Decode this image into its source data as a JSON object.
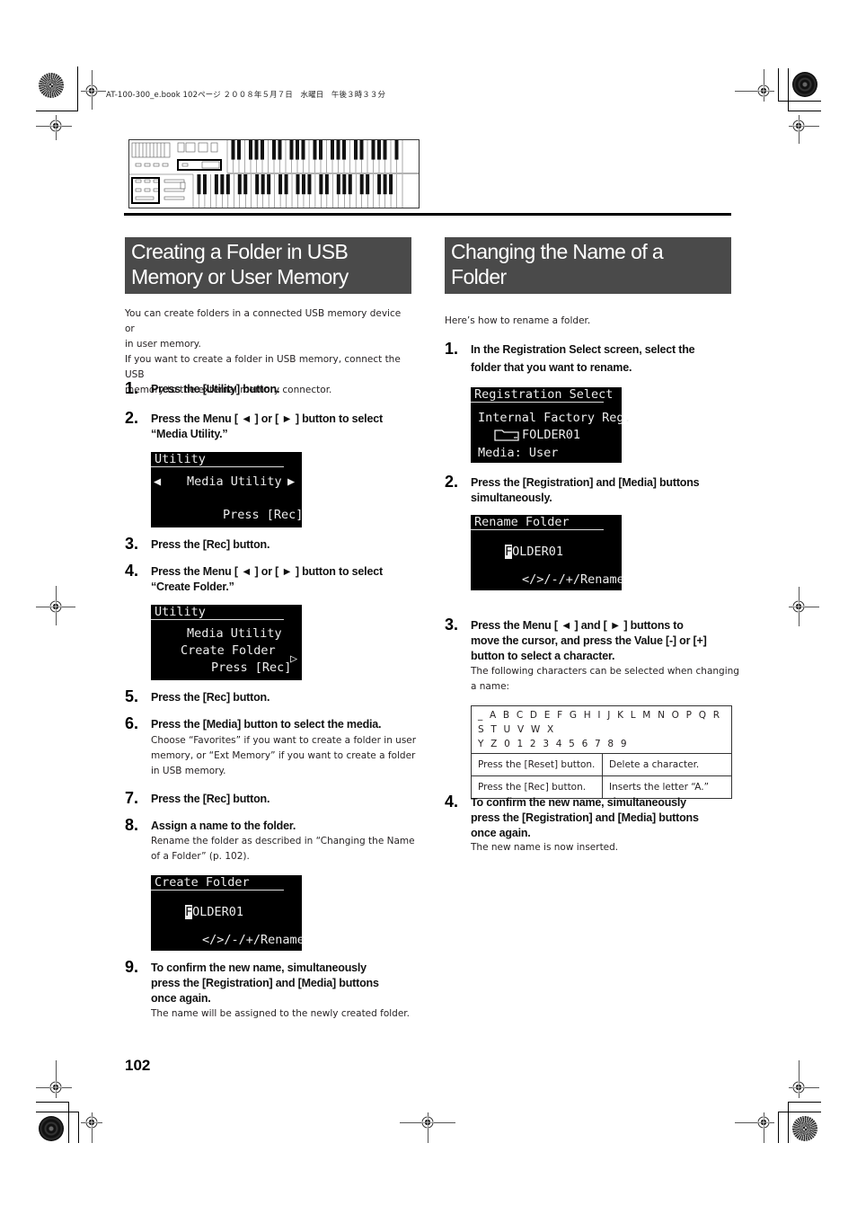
{
  "print_header": "AT-100-300_e.book  102ページ  ２００８年５月７日　水曜日　午後３時３３分",
  "left_section": {
    "title_line1": "Creating a Folder in USB",
    "title_line2": "Memory or User Memory",
    "intro": [
      "You can create folders in a connected USB memory device or",
      "in user memory.",
      "If you want to create a folder in USB memory, connect the USB",
      "memory to the external memory connector."
    ],
    "steps": [
      {
        "num": "1.",
        "lines": [
          "Press the [Utility] button."
        ]
      },
      {
        "num": "2.",
        "lines": [
          "Press the Menu [ ◄ ] or [ ► ] button to select",
          "“Media Utility.”"
        ]
      },
      {
        "num": "3.",
        "lines": [
          "Press the [Rec] button."
        ]
      },
      {
        "num": "4.",
        "lines": [
          "Press the Menu [ ◄ ] or [ ► ] button to select",
          "“Create Folder.”"
        ]
      },
      {
        "num": "5.",
        "lines": [
          "Press the [Rec] button."
        ]
      },
      {
        "num": "6.",
        "lines": [
          "Press the [Media] button to select the media."
        ],
        "sub": [
          "Choose “Favorites” if you want to create a folder in user",
          "memory, or “Ext Memory” if you want to create a folder",
          "in USB memory."
        ]
      },
      {
        "num": "7.",
        "lines": [
          "Press the [Rec] button."
        ]
      },
      {
        "num": "8.",
        "lines": [
          "Assign a name to the folder."
        ],
        "sub": [
          "Rename the folder as described in “Changing the Name",
          "of a Folder” (p. 102)."
        ]
      },
      {
        "num": "9.",
        "lines": [
          "To confirm the new name, simultaneously",
          "press the [Registration] and [Media] buttons",
          "once again."
        ],
        "sub": [
          "The name will be assigned to the newly created folder."
        ]
      }
    ],
    "lcd1": {
      "title": "Utility",
      "left_arrow": "◀",
      "center": "Media Utility",
      "right_arrow": "▶",
      "bottom": "Press [Rec]"
    },
    "lcd2": {
      "title": "Utility",
      "line1": "Media Utility",
      "line2": "Create Folder",
      "line3": "Press [Rec]",
      "right_arrow": "▷"
    },
    "lcd3": {
      "title": "Create Folder",
      "cursor_char": "F",
      "name_rest": "OLDER01",
      "bottom": "</>/-/+/Rename"
    }
  },
  "right_section": {
    "title_line1": "Changing the Name of a",
    "title_line2": "Folder",
    "intro": "Here’s how to rename a folder.",
    "steps": [
      {
        "num": "1.",
        "lines": [
          "In the Registration Select screen, select the",
          "folder that you want to rename."
        ]
      },
      {
        "num": "2.",
        "lines": [
          "Press the [Registration] and [Media] buttons",
          "simultaneously."
        ]
      },
      {
        "num": "3.",
        "lines": [
          "Press the Menu [ ◄ ] and [ ► ] buttons to",
          "move the cursor, and press the Value [-] or [+]",
          "button to select a character."
        ],
        "sub": [
          "The following characters can be selected when changing",
          "a name:"
        ]
      },
      {
        "num": "4.",
        "lines": [
          "To confirm the new name, simultaneously",
          "press the [Registration] and [Media] buttons",
          "once again."
        ],
        "sub": [
          "The new name is now inserted."
        ]
      }
    ],
    "lcd1": {
      "title": "Registration Select",
      "line1": "Internal Factory Reg.",
      "folder_icon": "folder-icon",
      "folder_name": "FOLDER01",
      "line3": "Media: User"
    },
    "lcd2": {
      "title": "Rename Folder",
      "cursor_char": "F",
      "name_rest": "OLDER01",
      "bottom": "</>/-/+/Rename"
    },
    "table": {
      "chars_line1": "_ A B C D E F G H I J K L M N O P Q R S T U V W X",
      "chars_line2": "Y Z 0 1 2 3 4 5 6 7 8 9",
      "rows": [
        {
          "action": "Press the [Reset] button.",
          "result": "Delete a character."
        },
        {
          "action": "Press the [Rec] button.",
          "result": "Inserts the letter “A.”"
        }
      ]
    }
  },
  "page_number": "102"
}
